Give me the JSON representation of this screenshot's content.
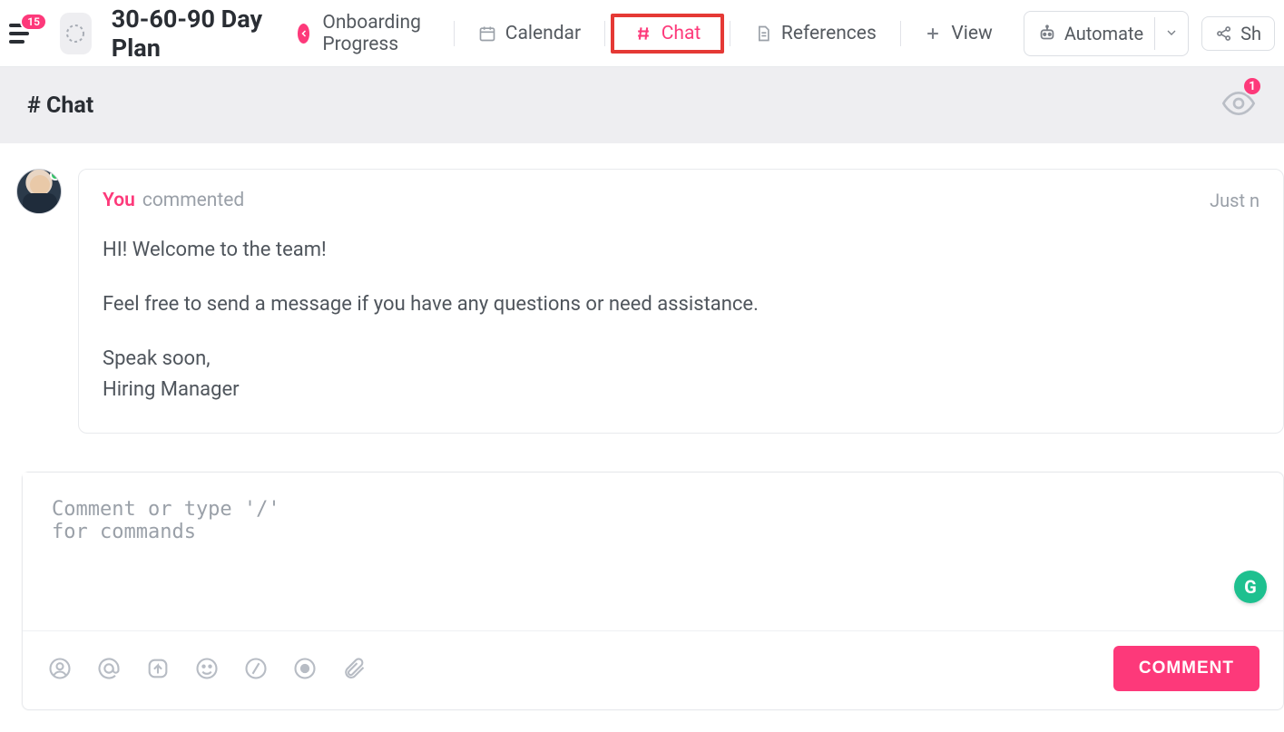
{
  "header": {
    "menu_badge": "15",
    "title": "30-60-90 Day Plan",
    "tabs": [
      {
        "label": "Onboarding Progress"
      },
      {
        "label": "Calendar"
      },
      {
        "label": "Chat"
      },
      {
        "label": "References"
      }
    ],
    "view_label": "View",
    "automate_label": "Automate",
    "share_label": "Sh"
  },
  "subheader": {
    "title": "# Chat",
    "watch_count": "1"
  },
  "message": {
    "author": "You",
    "verb": "commented",
    "timestamp": "Just n",
    "body_lines": [
      "HI! Welcome to the team!",
      "Feel free to send a message if you have any questions or need assistance.",
      "Speak soon,\nHiring Manager"
    ]
  },
  "composer": {
    "placeholder": "Comment or type '/' for commands",
    "submit_label": "COMMENT",
    "assistant_badge": "G"
  }
}
